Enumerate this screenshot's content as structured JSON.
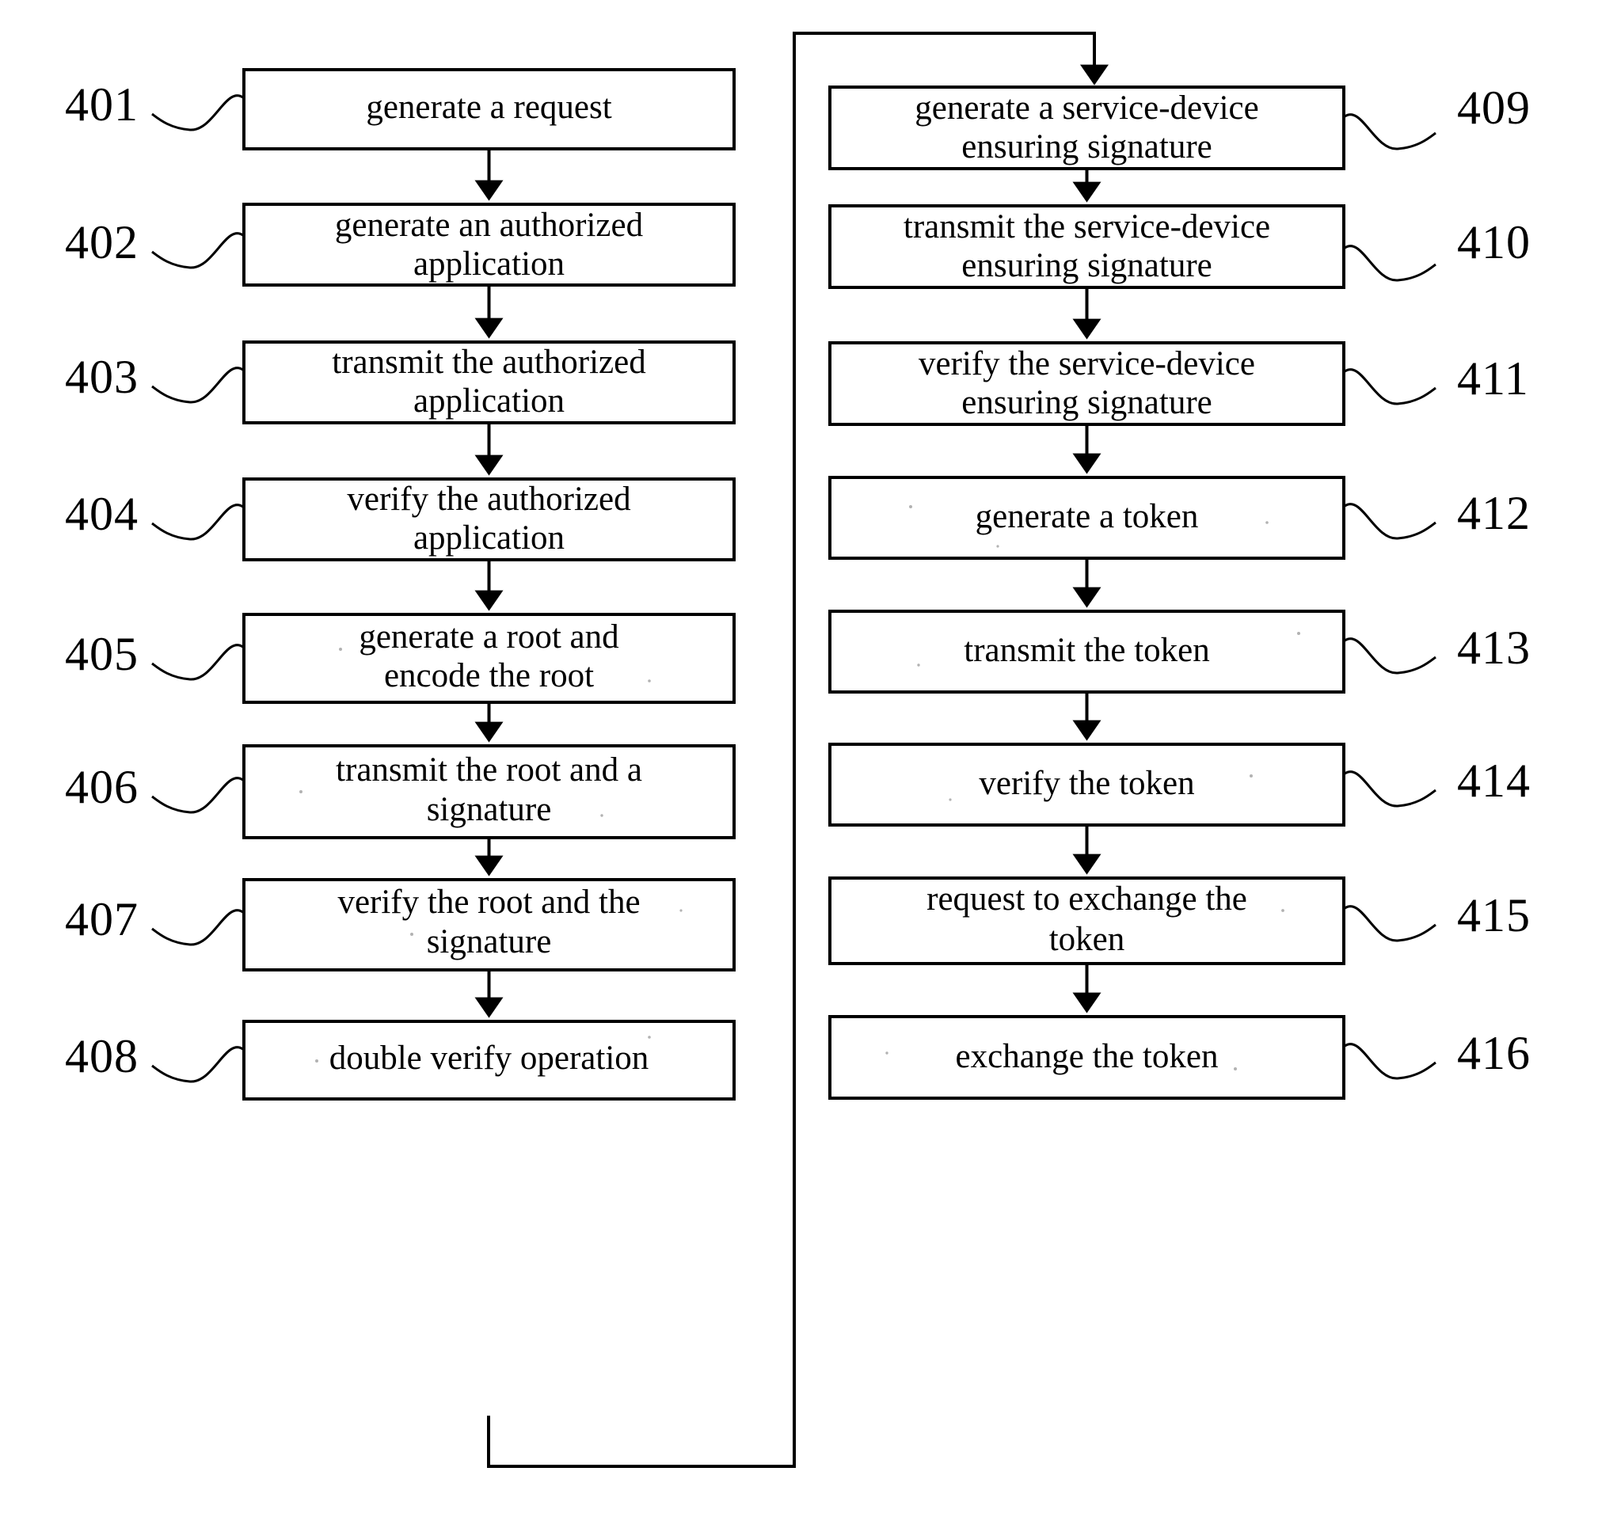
{
  "figure": {
    "type": "patent-flowchart",
    "orientation": "two-column",
    "background_color": "#ffffff",
    "line_color": "#000000"
  },
  "left_column": {
    "steps": [
      {
        "ref": "401",
        "label": "generate a request",
        "lines": [
          "generate a request"
        ]
      },
      {
        "ref": "402",
        "label": "generate an authorized application",
        "lines": [
          "generate an authorized",
          "application"
        ]
      },
      {
        "ref": "403",
        "label": "transmit the authorized application",
        "lines": [
          "transmit the authorized",
          "application"
        ]
      },
      {
        "ref": "404",
        "label": "verify the authorized application",
        "lines": [
          "verify the authorized",
          "application"
        ]
      },
      {
        "ref": "405",
        "label": "generate a root and encode the root",
        "lines": [
          "generate a root and",
          "encode the root"
        ]
      },
      {
        "ref": "406",
        "label": "transmit the root and a signature",
        "lines": [
          "transmit the root and a",
          "signature"
        ]
      },
      {
        "ref": "407",
        "label": "verify the root and the signature",
        "lines": [
          "verify the root and the",
          "signature"
        ]
      },
      {
        "ref": "408",
        "label": "double verify operation",
        "lines": [
          "double verify operation"
        ]
      }
    ]
  },
  "right_column": {
    "steps": [
      {
        "ref": "409",
        "label": "generate a service-device ensuring signature",
        "lines": [
          "generate a service-device",
          "ensuring signature"
        ]
      },
      {
        "ref": "410",
        "label": "transmit the service-device ensuring signature",
        "lines": [
          "transmit the service-device",
          "ensuring signature"
        ]
      },
      {
        "ref": "411",
        "label": "verify the service-device ensuring signature",
        "lines": [
          "verify the service-device",
          "ensuring signature"
        ]
      },
      {
        "ref": "412",
        "label": "generate a token",
        "lines": [
          "generate a token"
        ]
      },
      {
        "ref": "413",
        "label": "transmit the token",
        "lines": [
          "transmit the token"
        ]
      },
      {
        "ref": "414",
        "label": "verify the token",
        "lines": [
          "verify the token"
        ]
      },
      {
        "ref": "415",
        "label": "request to exchange the token",
        "lines": [
          "request to exchange the",
          "token"
        ]
      },
      {
        "ref": "416",
        "label": "exchange the token",
        "lines": [
          "exchange the token"
        ]
      }
    ]
  },
  "connectors": {
    "intra_column": "downward-arrow",
    "wrap": {
      "from": "408",
      "to": "409",
      "description": "line from bottom of step 408 routed down, right, up the right side of the left column, across the top, and down into step 409"
    }
  }
}
